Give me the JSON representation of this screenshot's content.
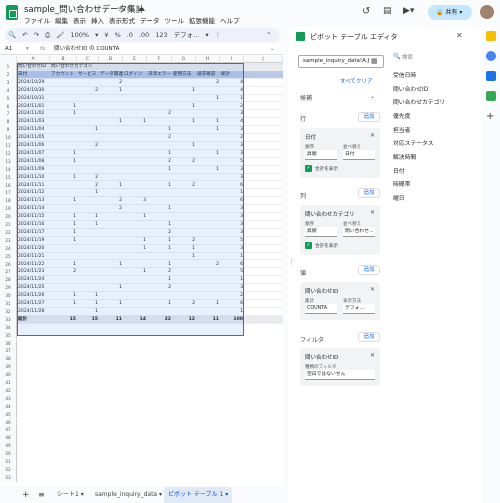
{
  "app": {
    "title": "sample_問い合わせデータ集計",
    "menu": [
      "ファイル",
      "編集",
      "表示",
      "挿入",
      "表示形式",
      "データ",
      "ツール",
      "拡張機能",
      "ヘルプ"
    ],
    "share_label": "共有"
  },
  "toolbar": {
    "zoom": "100%",
    "currency": "¥",
    "percent": "%",
    "dec1": ".0",
    "dec2": ".00",
    "fmt": "123",
    "font": "デフォ..."
  },
  "formula_bar": {
    "cell_ref": "A1",
    "fx": "fx",
    "content": "問い合わせID の COUNTA"
  },
  "grid": {
    "columns": [
      "A",
      "B",
      "C",
      "D",
      "E",
      "F",
      "G",
      "H",
      "I",
      "J"
    ],
    "row_numbers": [
      "1",
      "2",
      "3",
      "4",
      "5",
      "6",
      "7",
      "8",
      "9",
      "10",
      "11",
      "12",
      "13",
      "14",
      "15",
      "16",
      "17",
      "18",
      "19",
      "20",
      "21",
      "22",
      "23",
      "24",
      "25",
      "26",
      "27",
      "28",
      "29",
      "30",
      "31",
      "32",
      "33",
      "34",
      "35",
      "36",
      "37",
      "38",
      "39",
      "40",
      "41",
      "42",
      "43",
      "44",
      "45",
      "46",
      "47",
      "48",
      "49",
      "50",
      "51",
      "52",
      "53"
    ],
    "header1": [
      "問い合わせID",
      "問い合わせカテゴリ"
    ],
    "header2": [
      "日付",
      "アカウント",
      "サービス",
      "データ関連",
      "ログイン",
      "決済エラー",
      "使用方法",
      "請求確認",
      "総計"
    ],
    "rows": [
      [
        "2024/10/29",
        "",
        "",
        "2",
        "",
        "",
        "",
        "2",
        "4"
      ],
      [
        "2024/10/30",
        "",
        "2",
        "1",
        "",
        "",
        "1",
        "",
        "4"
      ],
      [
        "2024/10/31",
        "",
        "",
        "",
        "",
        "",
        "",
        "1",
        "1"
      ],
      [
        "2024/11/01",
        "1",
        "",
        "",
        "",
        "",
        "1",
        "",
        "2"
      ],
      [
        "2024/11/02",
        "1",
        "",
        "",
        "",
        "2",
        "",
        "",
        "3"
      ],
      [
        "2024/11/03",
        "",
        "",
        "1",
        "1",
        "",
        "1",
        "1",
        "4"
      ],
      [
        "2024/11/04",
        "",
        "1",
        "",
        "",
        "1",
        "",
        "1",
        "3"
      ],
      [
        "2024/11/05",
        "",
        "",
        "",
        "",
        "2",
        "",
        "",
        "2"
      ],
      [
        "2024/11/06",
        "",
        "2",
        "",
        "",
        "",
        "1",
        "",
        "3"
      ],
      [
        "2024/11/07",
        "1",
        "",
        "",
        "",
        "1",
        "",
        "1",
        "3"
      ],
      [
        "2024/11/08",
        "1",
        "",
        "",
        "",
        "2",
        "2",
        "",
        "5"
      ],
      [
        "2024/11/09",
        "",
        "",
        "",
        "",
        "1",
        "",
        "1",
        "3"
      ],
      [
        "2024/11/10",
        "1",
        "2",
        "",
        "",
        "",
        "",
        "",
        "3"
      ],
      [
        "2024/11/11",
        "",
        "2",
        "1",
        "",
        "1",
        "2",
        "",
        "6"
      ],
      [
        "2024/11/12",
        "",
        "1",
        "",
        "",
        "",
        "",
        "",
        "1"
      ],
      [
        "2024/11/13",
        "1",
        "",
        "2",
        "3",
        "",
        "",
        "",
        "6"
      ],
      [
        "2024/11/14",
        "",
        "",
        "2",
        "",
        "1",
        "",
        "",
        "3"
      ],
      [
        "2024/11/15",
        "1",
        "1",
        "",
        "1",
        "",
        "",
        "",
        "3"
      ],
      [
        "2024/11/16",
        "1",
        "1",
        "",
        "",
        "1",
        "",
        "",
        "3"
      ],
      [
        "2024/11/17",
        "1",
        "",
        "",
        "",
        "2",
        "",
        "",
        "3"
      ],
      [
        "2024/11/19",
        "1",
        "",
        "",
        "1",
        "1",
        "2",
        "",
        "5"
      ],
      [
        "2024/11/20",
        "",
        "",
        "",
        "1",
        "1",
        "1",
        "",
        "3"
      ],
      [
        "2024/11/21",
        "",
        "",
        "",
        "",
        "",
        "1",
        "",
        "1"
      ],
      [
        "2024/11/22",
        "1",
        "",
        "1",
        "",
        "1",
        "",
        "2",
        "6"
      ],
      [
        "2024/11/23",
        "2",
        "",
        "",
        "1",
        "2",
        "",
        "",
        "5"
      ],
      [
        "2024/11/24",
        "",
        "",
        "",
        "",
        "1",
        "",
        "",
        "1"
      ],
      [
        "2024/11/25",
        "",
        "",
        "1",
        "",
        "2",
        "",
        "",
        "3"
      ],
      [
        "2024/11/26",
        "1",
        "1",
        "",
        "",
        "",
        "",
        "",
        "2"
      ],
      [
        "2024/11/27",
        "1",
        "1",
        "1",
        "",
        "1",
        "2",
        "1",
        "6"
      ],
      [
        "2024/11/28",
        "",
        "1",
        "",
        "",
        "",
        "",
        "",
        "1"
      ]
    ],
    "total": [
      "総計",
      "15",
      "15",
      "11",
      "14",
      "22",
      "12",
      "11",
      "100"
    ]
  },
  "tabs": {
    "add": "+",
    "list": "≡",
    "sheet1": "シート1",
    "sheet2": "sample_inquiry_data",
    "sheet3": "ピボット テーブル 1"
  },
  "pivot_editor": {
    "title": "ピボット テーブル エディタ",
    "source": "sample_inquiry_data!A:J",
    "clear_all": "すべてクリア",
    "suggested": "候補",
    "rows_label": "行",
    "columns_label": "列",
    "values_label": "値",
    "filter_label": "フィルタ",
    "add_label": "追加",
    "row_card": {
      "title": "日付",
      "order_label": "順序",
      "order": "昇順",
      "sortby_label": "並べ替え",
      "sortby": "日付",
      "show_totals": "合計を表示"
    },
    "col_card": {
      "title": "問い合わせカテゴリ",
      "order_label": "順序",
      "order": "昇順",
      "sortby_label": "並べ替え",
      "sortby": "問い合わせ...",
      "show_totals": "合計を表示"
    },
    "value_card": {
      "title": "問い合わせID",
      "summarize_label": "集計",
      "summarize": "COUNTA",
      "showas_label": "表示方法",
      "showas": "デフォ..."
    },
    "filter_card": {
      "title": "問い合わせID",
      "status_label": "種類のフィルタ",
      "status": "空白ではないせん"
    }
  },
  "field_list": {
    "search_placeholder": "検索",
    "items": [
      "受信日時",
      "問い合わせID",
      "問い合わせカテゴリ",
      "優先度",
      "担当者",
      "対応ステータス",
      "解決時間",
      "日付",
      "時間帯",
      "曜日"
    ]
  },
  "colors": {
    "accent": "#1a73e8",
    "green": "#0f9d58",
    "share_bg": "#c2e7ff"
  }
}
